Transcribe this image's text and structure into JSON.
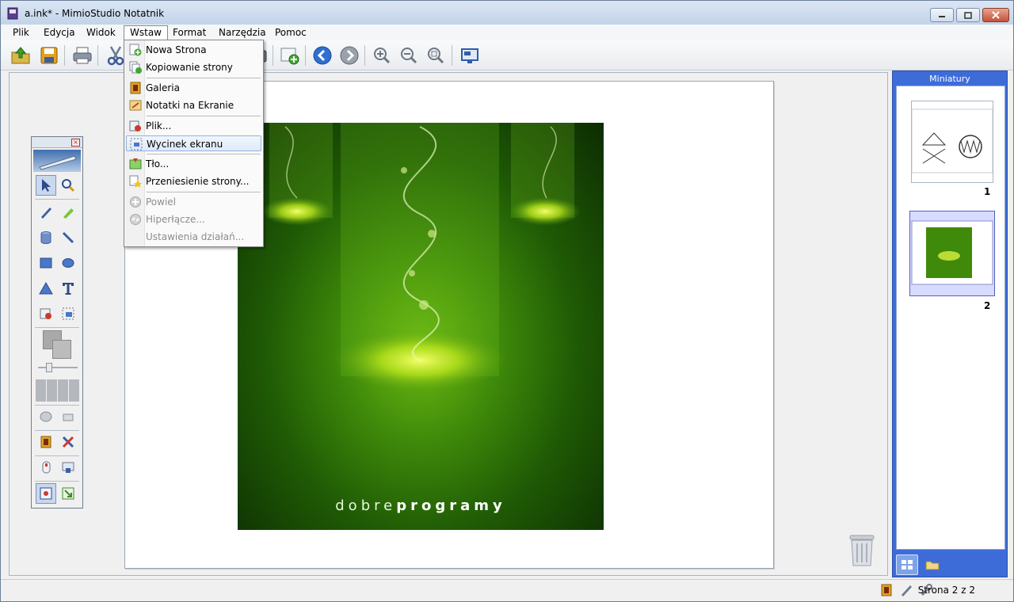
{
  "window": {
    "title": "a.ink* - MimioStudio Notatnik"
  },
  "menubar": {
    "items": [
      "Plik",
      "Edycja",
      "Widok",
      "Wstaw",
      "Format",
      "Narzędzia",
      "Pomoc"
    ],
    "open": "Wstaw"
  },
  "insert_menu": {
    "items": [
      {
        "label": "Nowa Strona",
        "icon": "new-page-icon",
        "enabled": true
      },
      {
        "label": "Kopiowanie strony",
        "icon": "copy-page-icon",
        "enabled": true
      },
      {
        "label": "Galeria",
        "icon": "gallery-icon",
        "enabled": true
      },
      {
        "label": "Notatki na Ekranie",
        "icon": "screen-notes-icon",
        "enabled": true
      },
      {
        "label": "Plik...",
        "icon": "file-icon",
        "enabled": true
      },
      {
        "label": "Wycinek ekranu",
        "icon": "screen-clip-icon",
        "enabled": true,
        "highlighted": true
      },
      {
        "label": "Tło...",
        "icon": "background-icon",
        "enabled": true
      },
      {
        "label": "Przeniesienie strony...",
        "icon": "page-transfer-icon",
        "enabled": true
      },
      {
        "label": "Powiel",
        "icon": "duplicate-icon",
        "enabled": false
      },
      {
        "label": "Hiperłącze...",
        "icon": "hyperlink-icon",
        "enabled": false
      },
      {
        "label": "Ustawienia działań...",
        "icon": "",
        "enabled": false
      }
    ]
  },
  "canvas": {
    "poster_text_light": "dobre",
    "poster_text_bold": "programy"
  },
  "sidepanel": {
    "title": "Miniatury",
    "pages": [
      {
        "number": "1",
        "selected": false
      },
      {
        "number": "2",
        "selected": true
      }
    ]
  },
  "status": {
    "page_indicator": "Strona 2 z 2"
  },
  "colors": {
    "titlebar": "#c2d4ea",
    "sidepanel": "#3d6cd9",
    "selected_thumb": "#d7dbff",
    "poster_green": "#3f8a0a"
  }
}
